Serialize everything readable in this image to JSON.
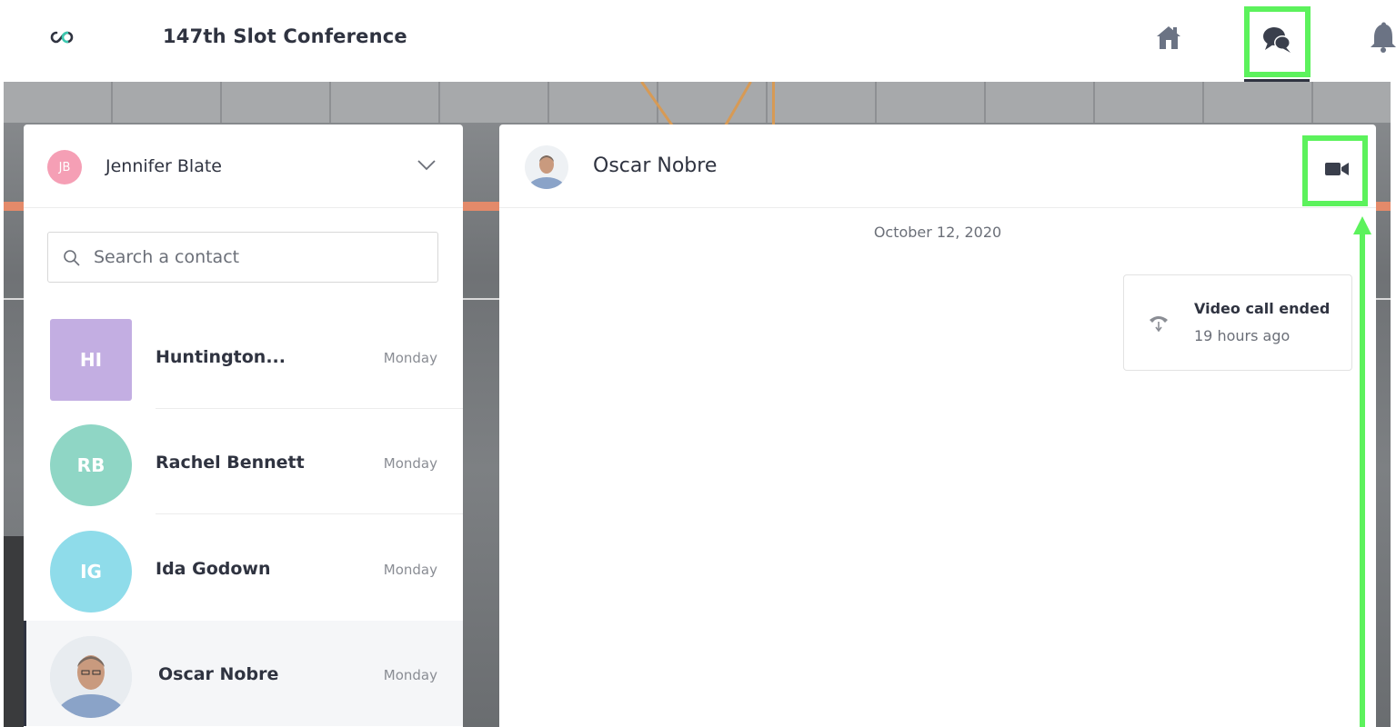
{
  "header": {
    "conference_title": "147th Slot Conference",
    "nav": {
      "home_icon": "home-icon",
      "chat_icon": "chat-bubbles-icon",
      "bell_icon": "bell-icon"
    },
    "highlight_color": "#5cf25c"
  },
  "user": {
    "initials": "JB",
    "name": "Jennifer Blate",
    "avatar_color": "#f59fb5"
  },
  "search": {
    "placeholder": "Search a contact"
  },
  "contacts": [
    {
      "initials": "HI",
      "name": "Huntington...",
      "time": "Monday",
      "avatar_color": "#c3aee2",
      "shape": "square"
    },
    {
      "initials": "RB",
      "name": "Rachel Bennett",
      "time": "Monday",
      "avatar_color": "#8fd6c5",
      "shape": "round"
    },
    {
      "initials": "IG",
      "name": "Ida Godown",
      "time": "Monday",
      "avatar_color": "#8fdcea",
      "shape": "round"
    },
    {
      "initials": "",
      "name": "Oscar Nobre",
      "time": "Monday",
      "avatar_color": "#dfe4ea",
      "shape": "photo"
    }
  ],
  "chat": {
    "contact_name": "Oscar Nobre",
    "date": "October 12, 2020",
    "messages": [
      {
        "title": "Video call ended",
        "time": "19 hours ago",
        "icon": "hangup-icon"
      }
    ]
  }
}
